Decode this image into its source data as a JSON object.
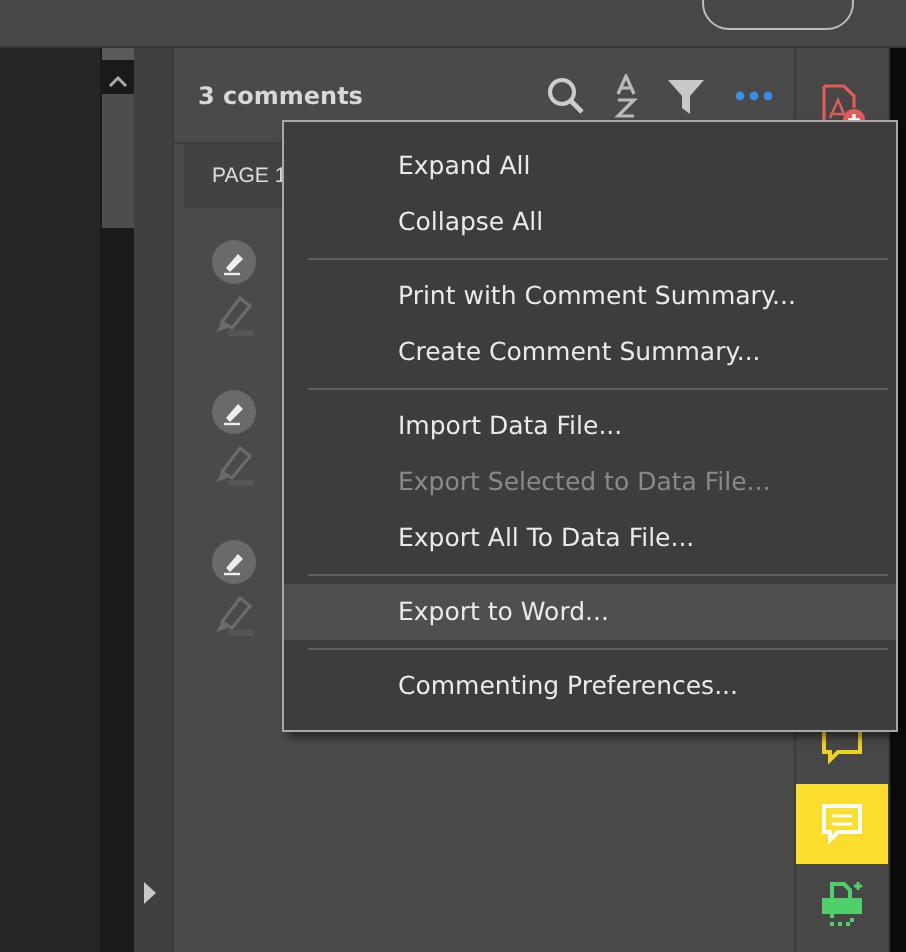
{
  "comments_panel": {
    "count": "3 comments",
    "page_header": "PAGE 1",
    "comments": [
      {
        "kind": "highlight"
      },
      {
        "kind": "highlight"
      },
      {
        "kind": "highlight"
      }
    ]
  },
  "menu": {
    "items": [
      {
        "kind": "item",
        "label": "Expand All",
        "disabled": false,
        "selected": false
      },
      {
        "kind": "item",
        "label": "Collapse All",
        "disabled": false,
        "selected": false
      },
      {
        "kind": "separator"
      },
      {
        "kind": "item",
        "label": "Print with Comment Summary...",
        "disabled": false,
        "selected": false
      },
      {
        "kind": "item",
        "label": "Create Comment Summary...",
        "disabled": false,
        "selected": false
      },
      {
        "kind": "separator"
      },
      {
        "kind": "item",
        "label": "Import Data File...",
        "disabled": false,
        "selected": false
      },
      {
        "kind": "item",
        "label": "Export Selected to Data File...",
        "disabled": true,
        "selected": false
      },
      {
        "kind": "item",
        "label": "Export All To Data File...",
        "disabled": false,
        "selected": false
      },
      {
        "kind": "separator"
      },
      {
        "kind": "item",
        "label": "Export to Word...",
        "disabled": false,
        "selected": true
      },
      {
        "kind": "separator"
      },
      {
        "kind": "item",
        "label": "Commenting Preferences...",
        "disabled": false,
        "selected": false
      }
    ]
  },
  "right_toolbar": {
    "tools": [
      {
        "kind": "create-pdf",
        "selected": false
      },
      {
        "kind": "yellow-comment",
        "selected": false
      },
      {
        "kind": "comment",
        "selected": true
      },
      {
        "kind": "print",
        "selected": false
      }
    ]
  }
}
